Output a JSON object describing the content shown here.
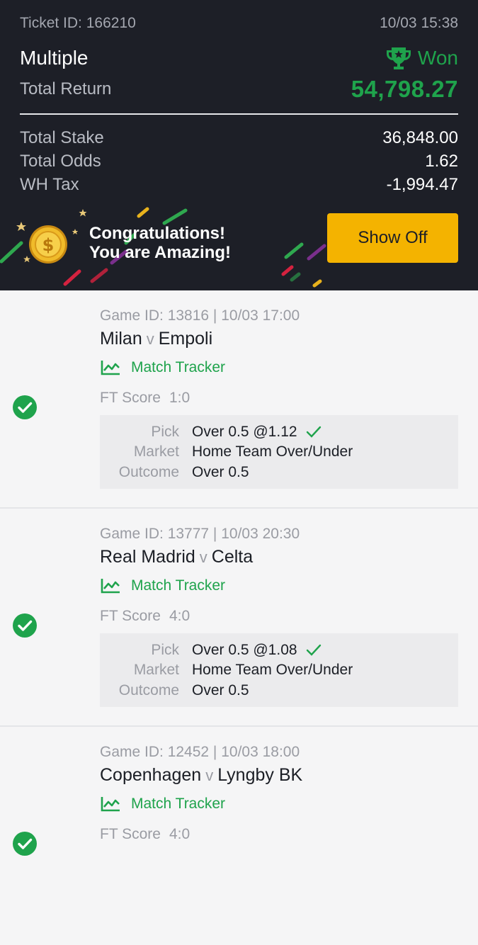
{
  "ticket": {
    "id_text": "Ticket ID: 166210",
    "datetime": "10/03 15:38",
    "bet_type": "Multiple",
    "status": "Won",
    "return_label": "Total Return",
    "return_value": "54,798.27"
  },
  "summary": [
    {
      "label": "Total Stake",
      "value": "36,848.00"
    },
    {
      "label": "Total Odds",
      "value": "1.62"
    },
    {
      "label": "WH Tax",
      "value": "-1,994.47"
    }
  ],
  "banner": {
    "line1": "Congratulations!",
    "line2": "You are Amazing!",
    "button": "Show Off"
  },
  "games": [
    {
      "header": "Game ID: 13816 | 10/03 17:00",
      "home": "Milan",
      "vs": "v",
      "away": "Empoli",
      "tracker": "Match Tracker",
      "score_label": "FT Score",
      "score": "1:0",
      "pick_label": "Pick",
      "pick": "Over 0.5 @1.12",
      "market_label": "Market",
      "market": "Home Team Over/Under",
      "outcome_label": "Outcome",
      "outcome": "Over 0.5"
    },
    {
      "header": "Game ID: 13777 | 10/03 20:30",
      "home": "Real Madrid",
      "vs": "v",
      "away": "Celta",
      "tracker": "Match Tracker",
      "score_label": "FT Score",
      "score": "4:0",
      "pick_label": "Pick",
      "pick": "Over 0.5 @1.08",
      "market_label": "Market",
      "market": "Home Team Over/Under",
      "outcome_label": "Outcome",
      "outcome": "Over 0.5"
    },
    {
      "header": "Game ID: 12452 | 10/03 18:00",
      "home": "Copenhagen",
      "vs": "v",
      "away": "Lyngby BK",
      "tracker": "Match Tracker",
      "score_label": "FT Score",
      "score": "4:0"
    }
  ],
  "colors": {
    "header_bg": "#1d1f27",
    "won_green": "#1fa34c",
    "button_yellow": "#f4b300",
    "page_bg": "#f5f5f6"
  },
  "icons": [
    "trophy-icon",
    "coin-icon",
    "chart-line-icon",
    "check-circle-icon",
    "checkmark-icon"
  ]
}
